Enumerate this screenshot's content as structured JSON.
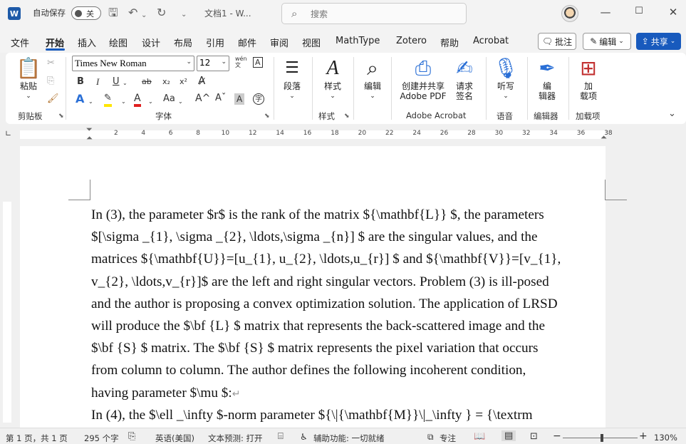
{
  "titlebar": {
    "autosave_label": "自动保存",
    "autosave_state": "关",
    "doc_title": "文档1 - W...",
    "search_placeholder": "搜索"
  },
  "menu": {
    "tabs": [
      "文件",
      "开始",
      "插入",
      "绘图",
      "设计",
      "布局",
      "引用",
      "邮件",
      "审阅",
      "视图",
      "MathType",
      "Zotero",
      "帮助",
      "Acrobat"
    ],
    "active": "开始",
    "comment_label": "批注",
    "edit_label": "编辑",
    "share_label": "共享"
  },
  "ribbon": {
    "paste": "粘贴",
    "clipboard_group": "剪贴板",
    "font_name": "Times New Roman",
    "font_size": "12",
    "wen_label": "wén",
    "font_group": "字体",
    "paragraph": "段落",
    "styles": "样式",
    "styles_group": "样式",
    "edit": "编辑",
    "acrobat_create_1": "创建并共享",
    "acrobat_create_2": "Adobe PDF",
    "acrobat_sign_1": "请求",
    "acrobat_sign_2": "签名",
    "acrobat_group": "Adobe Acrobat",
    "dictate": "听写",
    "voice_group": "语音",
    "editor_1": "编",
    "editor_2": "辑器",
    "editor_group": "编辑器",
    "addins_1": "加",
    "addins_2": "载项",
    "addins_group": "加载项"
  },
  "ruler": {
    "numbers": [
      "2",
      "4",
      "6",
      "8",
      "10",
      "12",
      "14",
      "16",
      "18",
      "20",
      "22",
      "24",
      "26",
      "28",
      "30",
      "32",
      "34",
      "36",
      "38"
    ]
  },
  "document": {
    "lines": [
      "In (3), the parameter $r$ is the rank of the matrix ${\\mathbf{L}} $, the parameters",
      "$[\\sigma _{1}, \\sigma _{2}, \\ldots,\\sigma _{n}] $ are the singular values, and the",
      "matrices ${\\mathbf{U}}=[u_{1}, u_{2}, \\ldots,u_{r}] $ and ${\\mathbf{V}}=[v_{1},",
      "v_{2}, \\ldots,v_{r}]$ are the left and right singular vectors. Problem (3) is ill-posed",
      "and the author is proposing a convex optimization solution. The application of LRSD",
      "will produce the $\\bf {L} $ matrix that represents the back-scattered image and the",
      "$\\bf {S} $ matrix. The $\\bf {S} $ matrix represents the pixel variation that occurs",
      "from column to column. The author defines the following incoherent condition,",
      "having parameter $\\mu $:",
      "In (4), the $\\ell _\\infty $-norm parameter ${\\|{\\mathbf{M}}\\|_\\infty } = {\\textrm"
    ]
  },
  "status": {
    "page": "第 1 页，共 1 页",
    "words": "295 个字",
    "language": "英语(美国)",
    "prediction": "文本预测: 打开",
    "accessibility": "辅助功能: 一切就绪",
    "focus": "专注",
    "zoom_minus": "−",
    "zoom_plus": "+",
    "zoom": "130%"
  }
}
